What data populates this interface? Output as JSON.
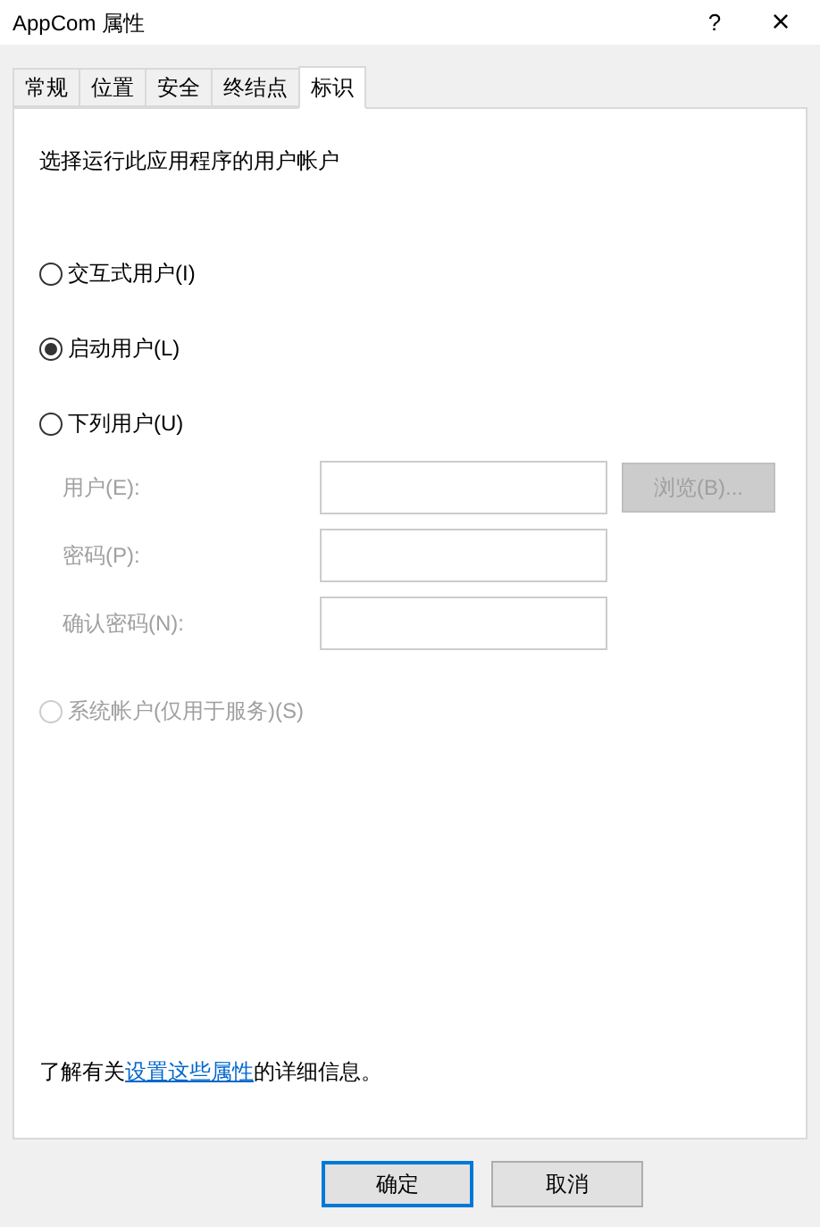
{
  "window": {
    "title": "AppCom 属性",
    "help": "?",
    "close": "×"
  },
  "tabs": [
    {
      "label": "常规",
      "selected": false
    },
    {
      "label": "位置",
      "selected": false
    },
    {
      "label": "安全",
      "selected": false
    },
    {
      "label": "终结点",
      "selected": false
    },
    {
      "label": "标识",
      "selected": true
    }
  ],
  "intro": "选择运行此应用程序的用户帐户",
  "options": [
    {
      "label": "交互式用户(I)",
      "selected": false,
      "disabled": false
    },
    {
      "label": "启动用户(L)",
      "selected": true,
      "disabled": false
    },
    {
      "label": "下列用户(U)",
      "selected": false,
      "disabled": false
    }
  ],
  "fields": [
    {
      "label": "用户(E):",
      "disabled": true
    },
    {
      "label": "密码(P):",
      "disabled": true
    },
    {
      "label": "确认密码(N):",
      "disabled": true
    }
  ],
  "browse": {
    "label": "浏览(B)...",
    "disabled": true
  },
  "system_option": {
    "label": "系统帐户(仅用于服务)(S)",
    "selected": false,
    "disabled": true
  },
  "info": {
    "before": "了解有关",
    "link": "设置这些属性",
    "after": "的详细信息。"
  },
  "buttons": [
    {
      "label": "确定",
      "default": true
    },
    {
      "label": "取消",
      "default": false
    }
  ]
}
